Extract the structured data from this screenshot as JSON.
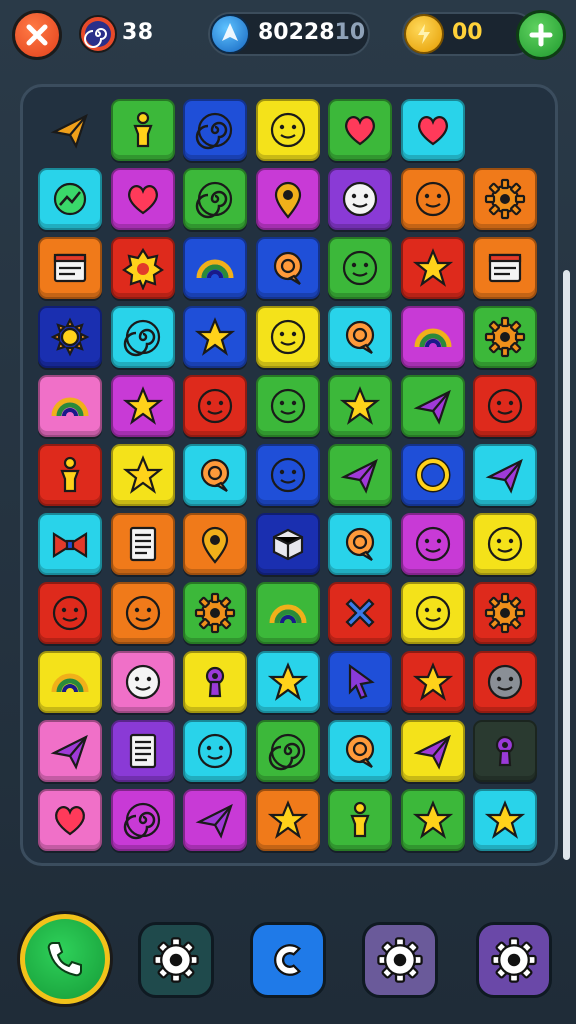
{
  "hud": {
    "swirl_count": "38",
    "score": "80228",
    "score_suffix": "10",
    "coins": "00"
  },
  "colors": {
    "green": "#3cb83a",
    "blue": "#1f4fd8",
    "yellow": "#f4e21a",
    "cyan": "#29d3ea",
    "magenta": "#c83ad6",
    "purple": "#8a3ad6",
    "orange": "#f07a1a",
    "red": "#de2a1c",
    "pink": "#f070c8",
    "darkblue": "#1a2fb0",
    "dark": "#2a3a30"
  },
  "board": {
    "rows": [
      [
        {
          "c": "none",
          "i": "paper-plane-orange"
        },
        {
          "c": "green",
          "i": "figure"
        },
        {
          "c": "blue",
          "i": "swirl"
        },
        {
          "c": "yellow",
          "i": "face"
        },
        {
          "c": "green",
          "i": "heart"
        },
        {
          "c": "cyan",
          "i": "heart"
        },
        null
      ],
      [
        {
          "c": "cyan",
          "i": "chart"
        },
        {
          "c": "magenta",
          "i": "heart"
        },
        {
          "c": "green",
          "i": "swirl"
        },
        {
          "c": "magenta",
          "i": "pin"
        },
        {
          "c": "purple",
          "i": "face-white"
        },
        {
          "c": "orange",
          "i": "face"
        },
        {
          "c": "orange",
          "i": "gear"
        }
      ],
      [
        {
          "c": "orange",
          "i": "window"
        },
        {
          "c": "red",
          "i": "star-badge"
        },
        {
          "c": "blue",
          "i": "rainbow"
        },
        {
          "c": "blue",
          "i": "chat"
        },
        {
          "c": "green",
          "i": "face"
        },
        {
          "c": "red",
          "i": "star"
        },
        {
          "c": "orange",
          "i": "window"
        }
      ],
      [
        {
          "c": "darkblue",
          "i": "sun"
        },
        {
          "c": "cyan",
          "i": "swirl"
        },
        {
          "c": "blue",
          "i": "star"
        },
        {
          "c": "yellow",
          "i": "face"
        },
        {
          "c": "cyan",
          "i": "chat"
        },
        {
          "c": "magenta",
          "i": "rainbow"
        },
        {
          "c": "green",
          "i": "gear"
        }
      ],
      [
        {
          "c": "pink",
          "i": "rainbow"
        },
        {
          "c": "magenta",
          "i": "star"
        },
        {
          "c": "red",
          "i": "face"
        },
        {
          "c": "green",
          "i": "face"
        },
        {
          "c": "green",
          "i": "star"
        },
        {
          "c": "green",
          "i": "paper-plane"
        },
        {
          "c": "red",
          "i": "face"
        }
      ],
      [
        {
          "c": "red",
          "i": "figure"
        },
        {
          "c": "yellow",
          "i": "star"
        },
        {
          "c": "cyan",
          "i": "chat"
        },
        {
          "c": "blue",
          "i": "face"
        },
        {
          "c": "green",
          "i": "paper-plane"
        },
        {
          "c": "blue",
          "i": "ring"
        },
        {
          "c": "cyan",
          "i": "paper-plane"
        }
      ],
      [
        {
          "c": "cyan",
          "i": "bow"
        },
        {
          "c": "orange",
          "i": "document"
        },
        {
          "c": "orange",
          "i": "pin"
        },
        {
          "c": "darkblue",
          "i": "box"
        },
        {
          "c": "cyan",
          "i": "chat"
        },
        {
          "c": "magenta",
          "i": "face"
        },
        {
          "c": "yellow",
          "i": "face"
        }
      ],
      [
        {
          "c": "red",
          "i": "face"
        },
        {
          "c": "orange",
          "i": "face"
        },
        {
          "c": "green",
          "i": "gear"
        },
        {
          "c": "green",
          "i": "rainbow"
        },
        {
          "c": "red",
          "i": "cross"
        },
        {
          "c": "yellow",
          "i": "face"
        },
        {
          "c": "red",
          "i": "gear"
        }
      ],
      [
        {
          "c": "yellow",
          "i": "rainbow"
        },
        {
          "c": "pink",
          "i": "face-white"
        },
        {
          "c": "yellow",
          "i": "keyhole"
        },
        {
          "c": "cyan",
          "i": "star"
        },
        {
          "c": "blue",
          "i": "cursor"
        },
        {
          "c": "red",
          "i": "star"
        },
        {
          "c": "red",
          "i": "face-gray"
        }
      ],
      [
        {
          "c": "pink",
          "i": "paper-plane"
        },
        {
          "c": "purple",
          "i": "document"
        },
        {
          "c": "cyan",
          "i": "face"
        },
        {
          "c": "green",
          "i": "swirl"
        },
        {
          "c": "cyan",
          "i": "chat"
        },
        {
          "c": "yellow",
          "i": "paper-plane"
        },
        {
          "c": "dark",
          "i": "keyhole"
        }
      ],
      [
        {
          "c": "pink",
          "i": "heart"
        },
        {
          "c": "magenta",
          "i": "swirl"
        },
        {
          "c": "magenta",
          "i": "paper-plane"
        },
        {
          "c": "orange",
          "i": "star"
        },
        {
          "c": "green",
          "i": "figure"
        },
        {
          "c": "green",
          "i": "star"
        },
        {
          "c": "cyan",
          "i": "star"
        }
      ]
    ]
  },
  "bottom_bar": [
    {
      "name": "call-button",
      "icon": "phone-icon"
    },
    {
      "name": "settings-button-1",
      "icon": "gear-icon",
      "color": "#1f4a4c"
    },
    {
      "name": "refresh-button",
      "icon": "c-arrow-icon",
      "color": "#1f7ae8"
    },
    {
      "name": "settings-button-2",
      "icon": "gear-icon",
      "color": "#6a5a9a"
    },
    {
      "name": "settings-button-3",
      "icon": "gear-icon",
      "color": "#6a48a8"
    }
  ]
}
